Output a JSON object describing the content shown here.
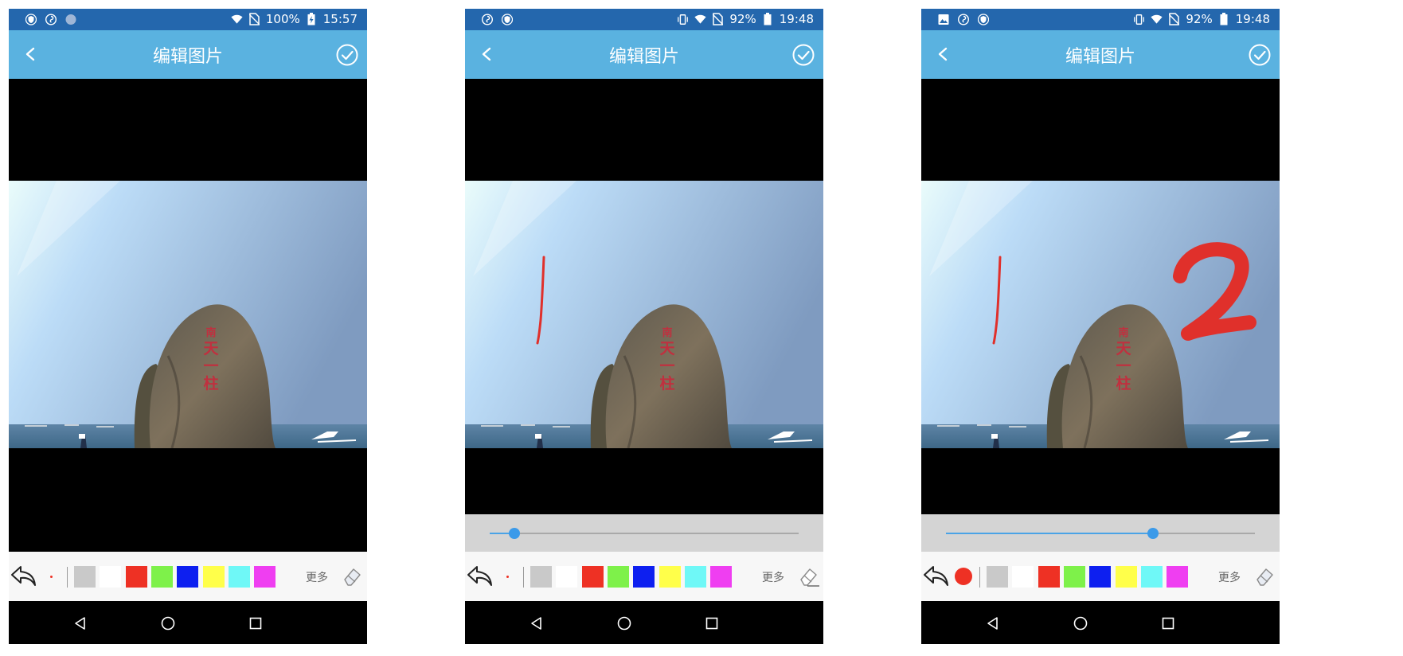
{
  "screens": [
    {
      "status": {
        "battery": "100%",
        "time": "15:57",
        "left_icons": [
          "shield-icon",
          "swirl-icon",
          "circle-icon"
        ],
        "charging": true,
        "vibrate": false
      },
      "app_bar": {
        "title": "编辑图片",
        "back_icon": "chevron-left-icon",
        "confirm_icon": "check-circle-icon"
      },
      "photo": {
        "rock_text": "南天一柱",
        "annotations": []
      },
      "slider": {
        "visible": false,
        "value_fraction": null
      },
      "toolbar": {
        "brush_size": "small",
        "more_label": "更多",
        "eraser_active": false
      },
      "palette": [
        "#c9c9c9",
        "#ffffff",
        "#ee3124",
        "#7ef14a",
        "#0d1ff0",
        "#ffff4a",
        "#6ff8f7",
        "#ef3ef1"
      ]
    },
    {
      "status": {
        "battery": "92%",
        "time": "19:48",
        "left_icons": [
          "swirl-icon",
          "shield-icon"
        ],
        "charging": false,
        "vibrate": true
      },
      "app_bar": {
        "title": "编辑图片",
        "back_icon": "chevron-left-icon",
        "confirm_icon": "check-circle-icon"
      },
      "photo": {
        "rock_text": "南天一柱",
        "annotations": [
          "stroke-line"
        ]
      },
      "slider": {
        "visible": true,
        "value_fraction": 0.08
      },
      "toolbar": {
        "brush_size": "small",
        "more_label": "更多",
        "eraser_active": true
      },
      "palette": [
        "#c9c9c9",
        "#ffffff",
        "#ee3124",
        "#7ef14a",
        "#0d1ff0",
        "#ffff4a",
        "#6ff8f7",
        "#ef3ef1"
      ]
    },
    {
      "status": {
        "battery": "92%",
        "time": "19:48",
        "left_icons": [
          "image-icon",
          "swirl-icon",
          "shield-icon"
        ],
        "charging": false,
        "vibrate": true
      },
      "app_bar": {
        "title": "编辑图片",
        "back_icon": "chevron-left-icon",
        "confirm_icon": "check-circle-icon"
      },
      "photo": {
        "rock_text": "南天一柱",
        "annotations": [
          "stroke-line",
          "stroke-digit-2"
        ]
      },
      "slider": {
        "visible": true,
        "value_fraction": 0.67
      },
      "toolbar": {
        "brush_size": "large",
        "more_label": "更多",
        "eraser_active": false
      },
      "palette": [
        "#c9c9c9",
        "#ffffff",
        "#ee3124",
        "#7ef14a",
        "#0d1ff0",
        "#ffff4a",
        "#6ff8f7",
        "#ef3ef1"
      ]
    }
  ],
  "navbar": {
    "icons": [
      "back-triangle-icon",
      "home-circle-icon",
      "recents-square-icon"
    ]
  }
}
